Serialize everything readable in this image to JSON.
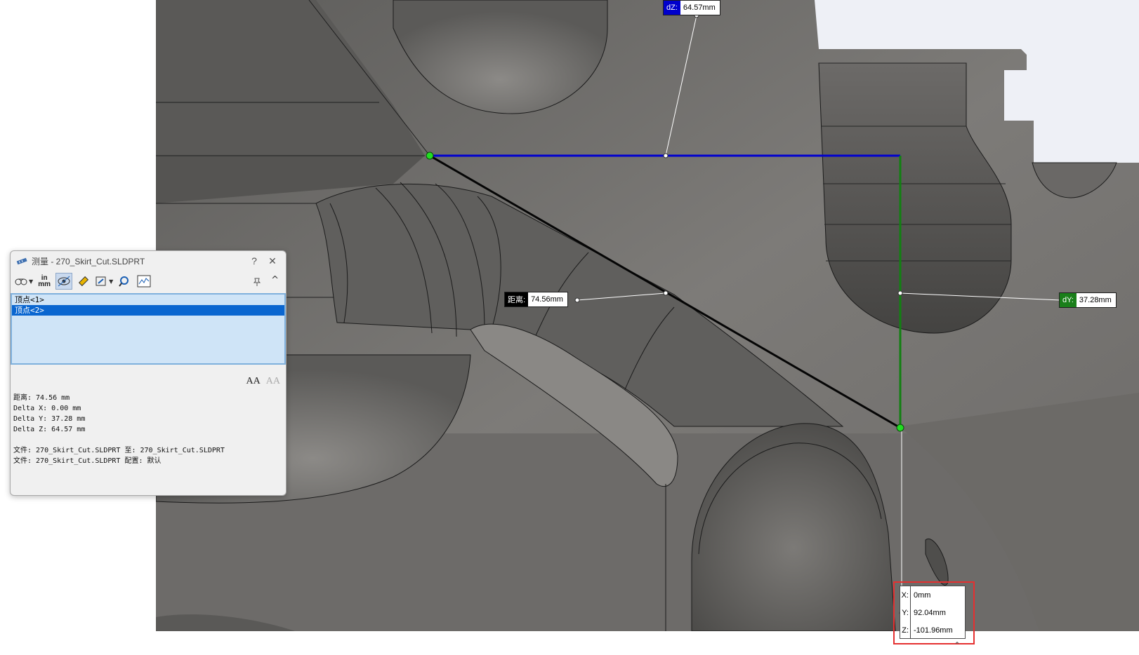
{
  "measure_dialog": {
    "title": "测量 - 270_Skirt_Cut.SLDPRT",
    "help_label": "?",
    "close_label": "✕",
    "collapse_label": "^",
    "units_icon": {
      "top": "in",
      "bottom": "mm"
    },
    "selections": [
      {
        "label": "顶点<1>",
        "selected": false
      },
      {
        "label": "顶点<2>",
        "selected": true
      }
    ],
    "results": {
      "distance": "距离: 74.56 mm",
      "delta_x": "Delta X: 0.00 mm",
      "delta_y": "Delta Y: 37.28 mm",
      "delta_z": "Delta Z: 64.57 mm",
      "file_line_1": "文件: 270_Skirt_Cut.SLDPRT 至: 270_Skirt_Cut.SLDPRT",
      "file_line_2": "文件: 270_Skirt_Cut.SLDPRT 配置: 默认"
    },
    "font_buttons": [
      "AA",
      "AA"
    ]
  },
  "callouts": {
    "dz": {
      "tag": "dZ:",
      "value": "64.57mm",
      "color": "#0000cc"
    },
    "distance": {
      "tag": "距离:",
      "value": "74.56mm",
      "color": "#000000"
    },
    "dy": {
      "tag": "dY:",
      "value": "37.28mm",
      "color": "#1a7f1a"
    }
  },
  "xyz_box": {
    "x_key": "X:",
    "x_val": "0mm",
    "y_key": "Y:",
    "y_val": "92.04mm",
    "z_key": "Z:",
    "z_val": "-101.96mm"
  },
  "colors": {
    "model_gray": "#7a7875",
    "dz_line": "#0000d0",
    "dy_line": "#128012",
    "vertex": "#22dd22",
    "highlight": "#e53030",
    "selection_bg": "#cfe4f7",
    "selection_active": "#0a66d0"
  }
}
